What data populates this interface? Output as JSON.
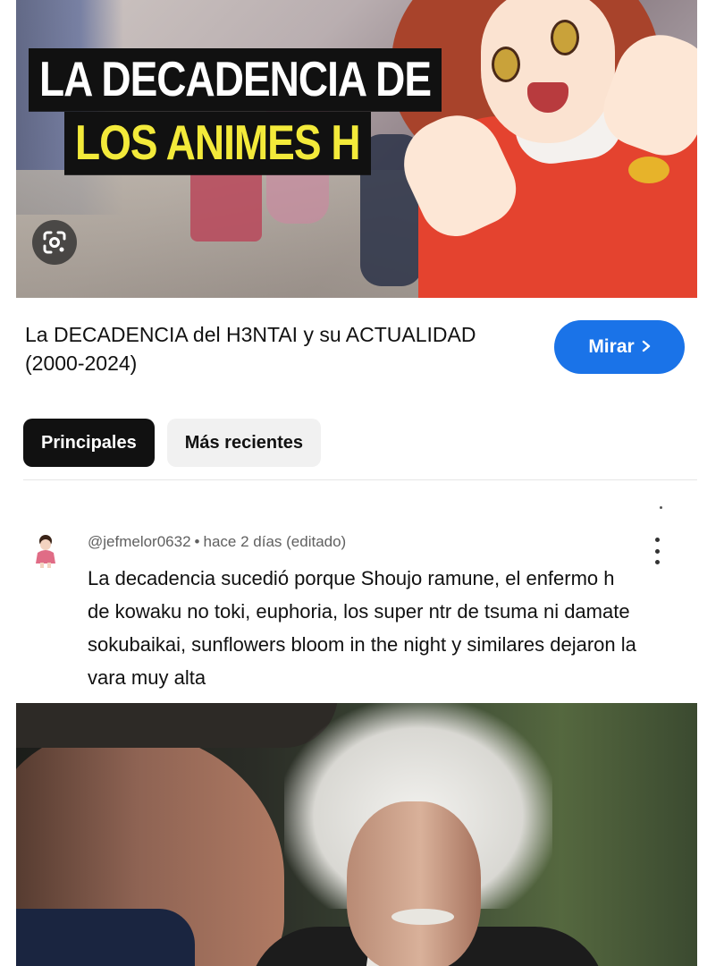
{
  "thumbnail": {
    "title_line1": "LA DECADENCIA DE",
    "title_line2": "LOS ANIMES H",
    "line2_color": "#f3ea3a",
    "lens_icon": "google-lens-icon"
  },
  "video": {
    "title": "La DECADENCIA del H3NTAI y su ACTUALIDAD (2000-2024)",
    "watch_label": "Mirar",
    "watch_icon": "chevron-right-icon",
    "accent": "#1a73e8"
  },
  "tabs": [
    {
      "label": "Principales",
      "active": true
    },
    {
      "label": "Más recientes",
      "active": false
    }
  ],
  "comment": {
    "author": "@jefmelor0632",
    "time": "hace 2 días (editado)",
    "text": "La decadencia sucedió porque Shoujo ramune, el enfermo h de kowaku no toki,  euphoria, los super ntr de tsuma ni damate sokubaikai, sunflowers bloom in the night y similares dejaron la vara muy alta",
    "menu_icon": "more-vertical-icon"
  }
}
